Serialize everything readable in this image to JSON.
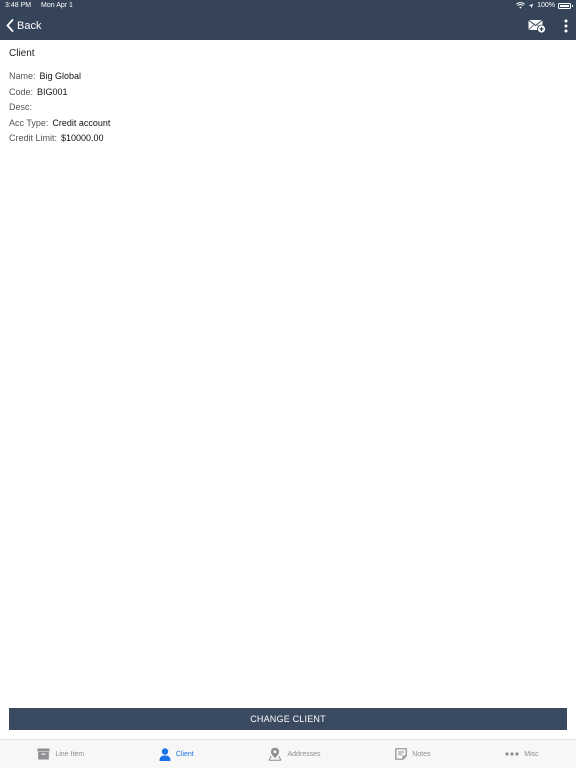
{
  "status_bar": {
    "time": "3:48 PM",
    "date": "Mon Apr 1",
    "battery": "100%"
  },
  "navbar": {
    "back_label": "Back"
  },
  "client": {
    "section_title": "Client",
    "fields": [
      {
        "label": "Name:",
        "value": "Big Global"
      },
      {
        "label": "Code:",
        "value": "BIG001"
      },
      {
        "label": "Desc:",
        "value": ""
      },
      {
        "label": "Acc Type:",
        "value": "Credit account"
      },
      {
        "label": "Credit Limit:",
        "value": "$10000.00"
      }
    ]
  },
  "change_button": {
    "label": "CHANGE CLIENT"
  },
  "tabs": [
    {
      "label": "Line Item",
      "icon": "archive-box-icon"
    },
    {
      "label": "Client",
      "icon": "person-icon",
      "active": true
    },
    {
      "label": "Addresses",
      "icon": "map-pin-icon"
    },
    {
      "label": "Notes",
      "icon": "notes-icon"
    },
    {
      "label": "Misc",
      "icon": "more-dots-icon"
    }
  ],
  "colors": {
    "header": "#354459",
    "button": "#3a4a60",
    "active_tab": "#1a73e8",
    "inactive_tab": "#8e8e93"
  }
}
